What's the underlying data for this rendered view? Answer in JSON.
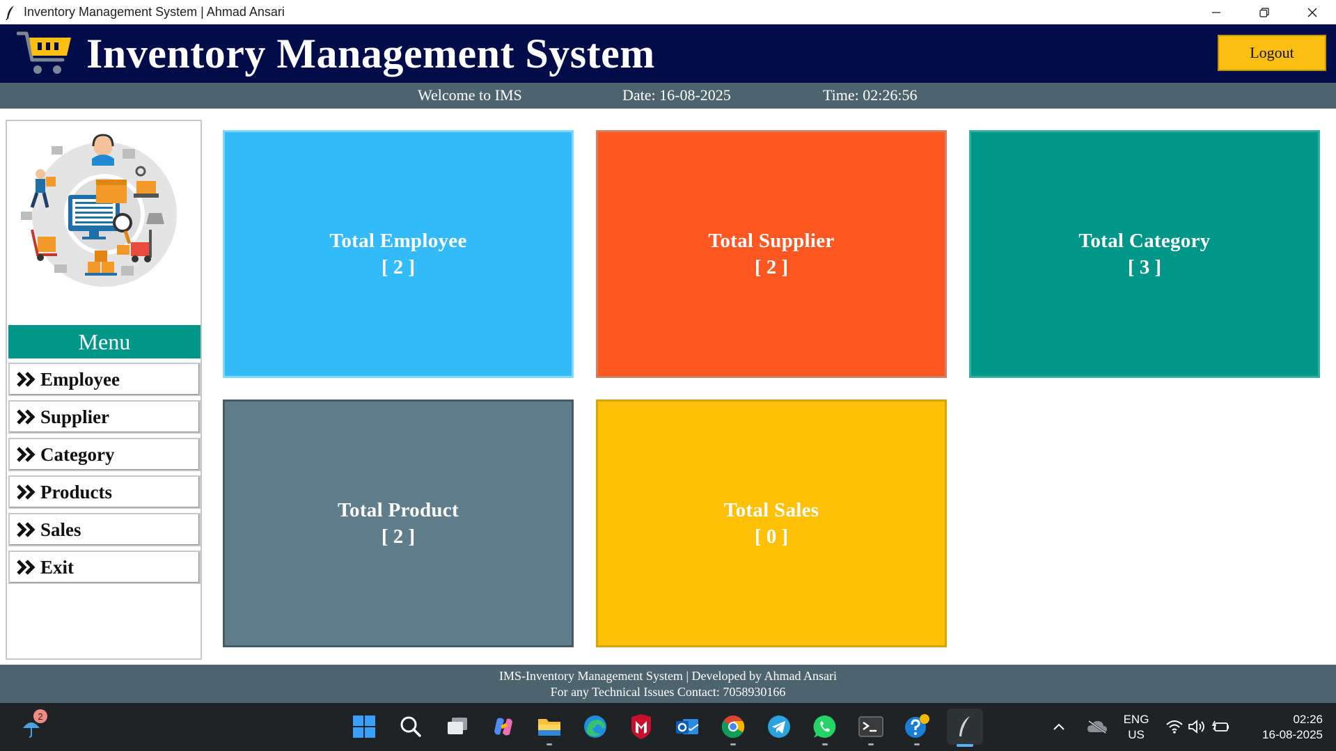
{
  "window": {
    "title": "Inventory Management System | Ahmad Ansari",
    "minimize_icon": "minimize-icon",
    "restore_icon": "restore-icon",
    "close_icon": "close-icon"
  },
  "header": {
    "title": "Inventory Management System",
    "logout_label": "Logout",
    "colors": {
      "background": "#010c48",
      "logout": "#fbbf14"
    }
  },
  "infobar": {
    "welcome": "Welcome to IMS",
    "date": "Date: 16-08-2025",
    "time": "Time: 02:26:56"
  },
  "menu": {
    "title": "Menu",
    "items": [
      {
        "label": "Employee",
        "icon": "double-chevron-right-icon"
      },
      {
        "label": "Supplier",
        "icon": "double-chevron-right-icon"
      },
      {
        "label": "Category",
        "icon": "double-chevron-right-icon"
      },
      {
        "label": "Products",
        "icon": "double-chevron-right-icon"
      },
      {
        "label": "Sales",
        "icon": "double-chevron-right-icon"
      },
      {
        "label": "Exit",
        "icon": "double-chevron-right-icon"
      }
    ]
  },
  "tiles": [
    {
      "label": "Total Employee",
      "count": "[ 2 ]",
      "color": "#33bbf9"
    },
    {
      "label": "Total Supplier",
      "count": "[ 2 ]",
      "color": "#ff5722"
    },
    {
      "label": "Total Category",
      "count": "[ 3 ]",
      "color": "#009688"
    },
    {
      "label": "Total Product",
      "count": "[ 2 ]",
      "color": "#607d8b"
    },
    {
      "label": "Total Sales",
      "count": "[ 0 ]",
      "color": "#ffc107"
    }
  ],
  "footer": {
    "line1": "IMS-Inventory Management System | Developed by Ahmad Ansari",
    "line2": "For any Technical Issues Contact: 7058930166"
  },
  "taskbar": {
    "weather_badge": "2",
    "icons": [
      "windows-start-icon",
      "search-icon",
      "task-view-icon",
      "copilot-icon",
      "file-explorer-icon",
      "edge-icon",
      "mcafee-icon",
      "outlook-icon",
      "chrome-icon",
      "telegram-icon",
      "whatsapp-icon",
      "terminal-icon",
      "help-icon",
      "feather-app-icon"
    ],
    "tray": {
      "language": "ENG",
      "region": "US",
      "time": "02:26",
      "date": "16-08-2025"
    }
  }
}
